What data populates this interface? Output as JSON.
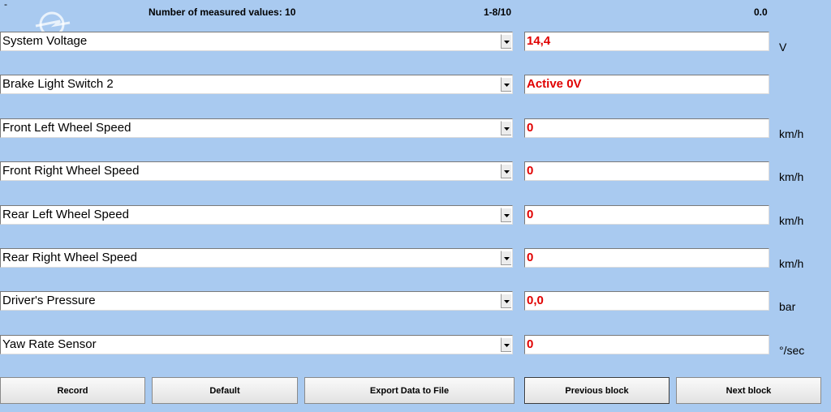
{
  "header": {
    "corner_mark": "-",
    "count_label": "Number of measured values: 10",
    "range_label": "1-8/10",
    "time_value": "0.0"
  },
  "rows": [
    {
      "label": "System Voltage",
      "value": "14,4",
      "unit": "V"
    },
    {
      "label": "Brake Light Switch 2",
      "value": "Active 0V",
      "unit": ""
    },
    {
      "label": "Front Left Wheel Speed",
      "value": "0",
      "unit": "km/h"
    },
    {
      "label": "Front Right Wheel Speed",
      "value": "0",
      "unit": "km/h"
    },
    {
      "label": "Rear Left Wheel Speed",
      "value": "0",
      "unit": "km/h"
    },
    {
      "label": "Rear Right Wheel Speed",
      "value": "0",
      "unit": "km/h"
    },
    {
      "label": "Driver's Pressure",
      "value": "0,0",
      "unit": "bar"
    },
    {
      "label": "Yaw Rate Sensor",
      "value": "0",
      "unit": "°/sec"
    }
  ],
  "buttons": {
    "record": "Record",
    "default": "Default",
    "export": "Export Data to File",
    "previous": "Previous block",
    "next": "Next block"
  },
  "colors": {
    "background": "#a9caf0",
    "value_text": "#e00000"
  },
  "icons": {
    "logo": "opel-logo-watermark",
    "dropdown": "dropdown-arrow-icon"
  }
}
